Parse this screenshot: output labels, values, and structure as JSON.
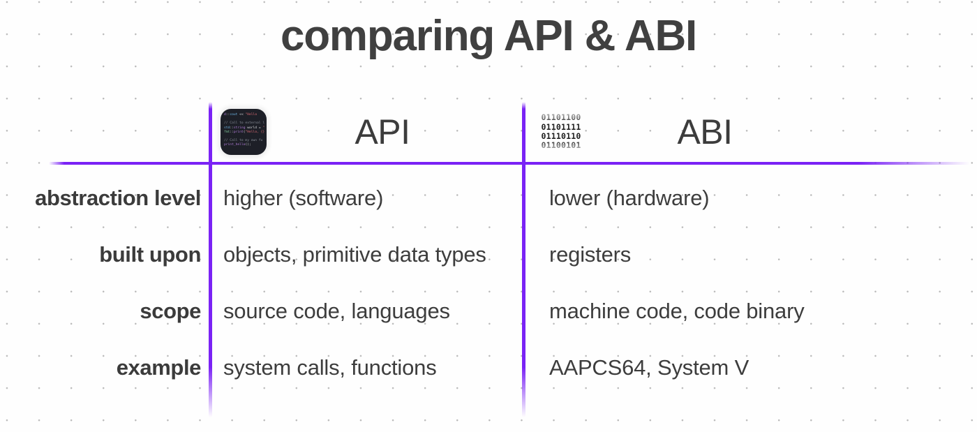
{
  "slide": {
    "title": "comparing API & ABI",
    "accent_color": "#7A22F5",
    "text_color": "#3d3d3d",
    "background_color": "#fefefe",
    "dot_grid_color": "#b9b9b9"
  },
  "columns": [
    {
      "id": "api",
      "title": "API",
      "icon_name": "code-snippet-thumbnail-icon",
      "icon_lines": [
        "d::cout << \"Hello",
        "// Call to external l",
        "std::string world = \"",
        "fmt::print(\"Hello, {}",
        "// Call to my own fu",
        "print_hello();"
      ]
    },
    {
      "id": "abi",
      "title": "ABI",
      "icon_name": "binary-digits-icon",
      "icon_lines": [
        "01101100",
        "01101111",
        "01110110",
        "01100101"
      ]
    }
  ],
  "rows": [
    {
      "label": "abstraction level",
      "api": "higher (software)",
      "abi": "lower (hardware)"
    },
    {
      "label": "built upon",
      "api": "objects, primitive data types",
      "abi": "registers"
    },
    {
      "label": "scope",
      "api": "source code, languages",
      "abi": "machine code, code binary"
    },
    {
      "label": "example",
      "api": "system calls, functions",
      "abi": "AAPCS64, System V"
    }
  ]
}
